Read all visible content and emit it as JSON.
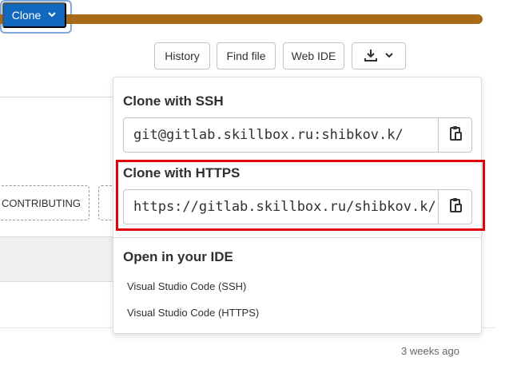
{
  "toolbar": {
    "history_label": "History",
    "find_file_label": "Find file",
    "web_ide_label": "Web IDE",
    "clone_label": "Clone"
  },
  "background": {
    "contributing_label": "CONTRIBUTING",
    "last_update": "3 weeks ago"
  },
  "clone_dropdown": {
    "ssh_title": "Clone with SSH",
    "ssh_url": "git@gitlab.skillbox.ru:shibkov.k/",
    "https_title": "Clone with HTTPS",
    "https_url": "https://gitlab.skillbox.ru/shibkov.k/",
    "ide_title": "Open in your IDE",
    "ide_options": [
      "Visual Studio Code (SSH)",
      "Visual Studio Code (HTTPS)"
    ]
  },
  "colors": {
    "accent": "#1068bf",
    "progress": "#a86a17",
    "highlight": "#e0000c"
  }
}
